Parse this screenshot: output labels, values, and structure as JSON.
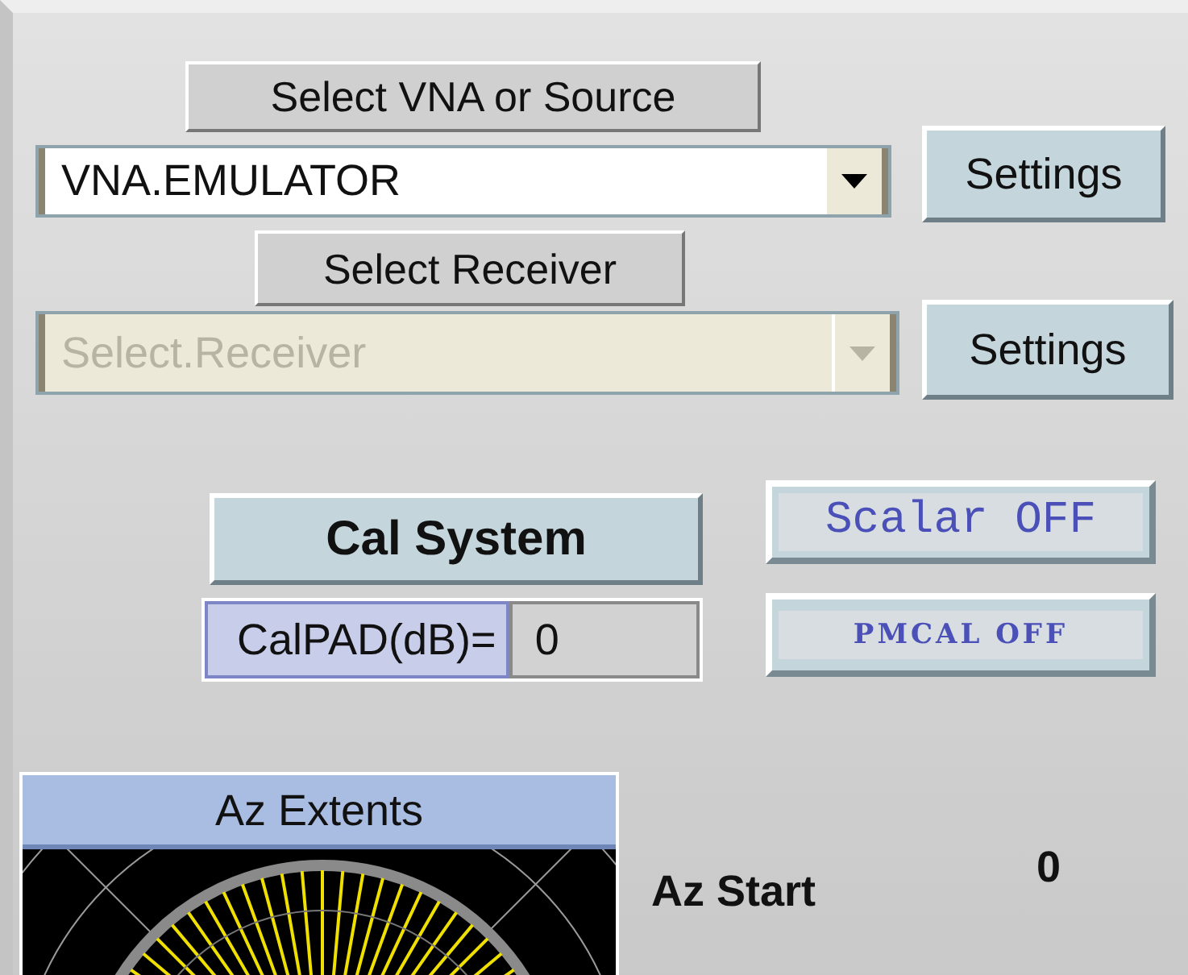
{
  "source_button": "Select VNA or Source",
  "source_select": {
    "value": "VNA.EMULATOR",
    "disabled": false
  },
  "source_settings": "Settings",
  "receiver_button": "Select Receiver",
  "receiver_select": {
    "value": "Select.Receiver",
    "disabled": true
  },
  "receiver_settings": "Settings",
  "cal_system": "Cal System",
  "calpad": {
    "label": "CalPAD(dB)=",
    "value": "0"
  },
  "scalar_toggle": "Scalar OFF",
  "pmcal_toggle": "PMCAL OFF",
  "az_extents": {
    "title": "Az Extents"
  },
  "az_start": {
    "label": "Az Start",
    "value": "0"
  }
}
